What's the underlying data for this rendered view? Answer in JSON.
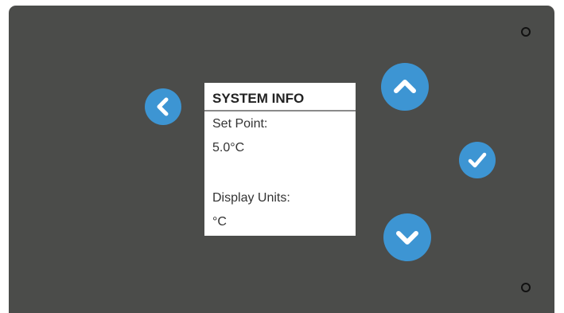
{
  "device": {
    "screen": {
      "title": "SYSTEM INFO",
      "lines": [
        "Set Point:",
        "5.0°C",
        "Display Units:",
        "°C"
      ]
    },
    "buttons": {
      "back_icon": "chevron-left-icon",
      "up_icon": "chevron-up-icon",
      "confirm_icon": "checkmark-icon",
      "down_icon": "chevron-down-icon"
    },
    "colors": {
      "panel": "#4b4c4a",
      "button": "#3d95d3",
      "screen": "#ffffff"
    }
  }
}
